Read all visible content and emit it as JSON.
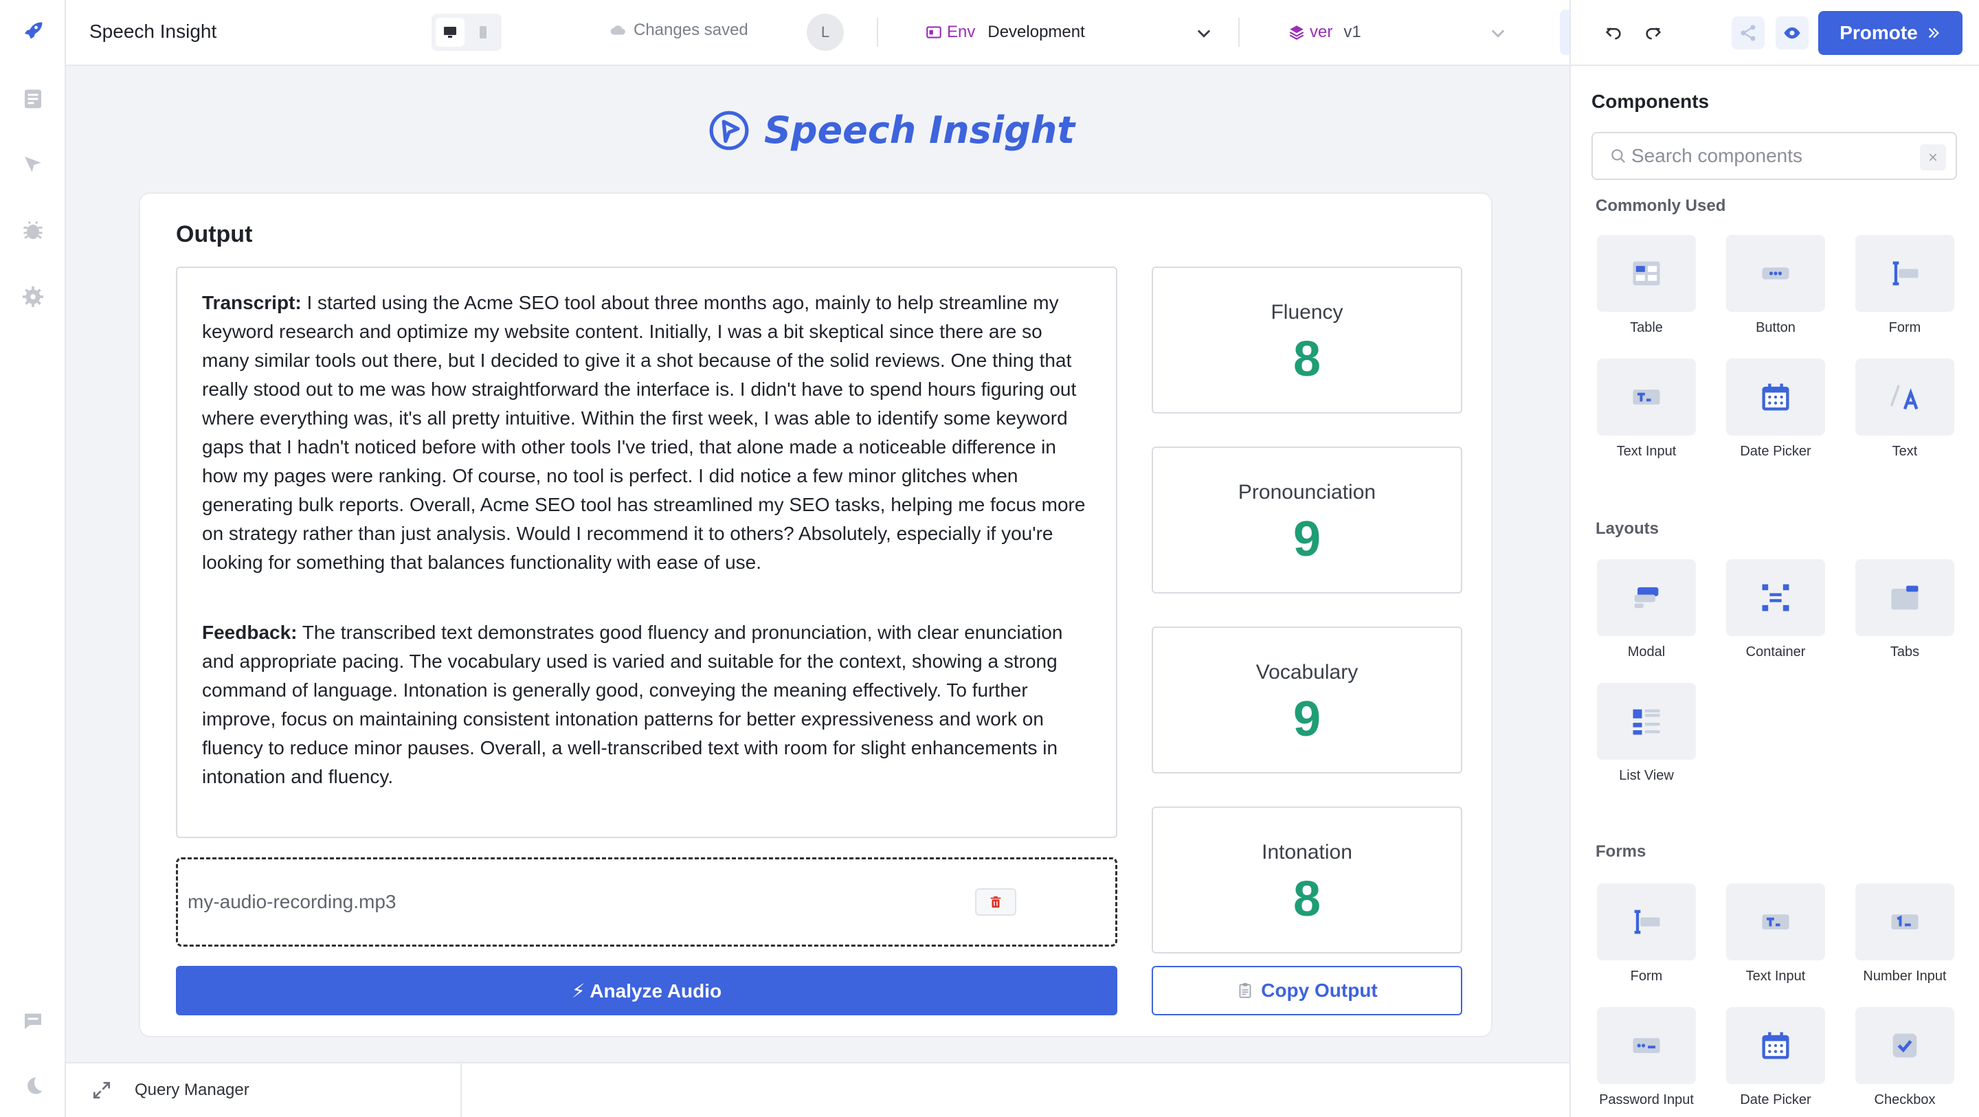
{
  "app": {
    "title": "Speech Insight"
  },
  "topbar": {
    "saved_status": "Changes saved",
    "avatar_initial": "L",
    "env_label": "Env",
    "env_value": "Development",
    "ver_label": "ver",
    "ver_value": "v1",
    "promote_label": "Promote"
  },
  "canvas": {
    "brand_title": "Speech Insight",
    "output_title": "Output",
    "transcript_label": "Transcript:",
    "transcript_text": " I started using the Acme SEO tool about three months ago, mainly to help streamline my keyword research and optimize my website content. Initially, I was a bit skeptical since there are so many similar tools out there, but I decided to give it a shot because of the solid reviews. One thing that really stood out to me was how straightforward the interface is. I didn't have to spend hours figuring out where everything was, it's all pretty intuitive. Within the first week, I was able to identify some keyword gaps that I hadn't noticed before with other tools I've tried, that alone made a noticeable difference in how my pages were ranking. Of course, no tool is perfect. I did notice a few minor glitches when generating bulk reports. Overall, Acme SEO tool has streamlined my SEO tasks, helping me focus more on strategy rather than just analysis. Would I recommend it to others? Absolutely, especially if you're looking for something that balances functionality with ease of use.",
    "feedback_label": "Feedback:",
    "feedback_text": " The transcribed text demonstrates good fluency and pronunciation, with clear enunciation and appropriate pacing. The vocabulary used is varied and suitable for the context, showing a strong command of language. Intonation is generally good, conveying the meaning effectively. To further improve, focus on maintaining consistent intonation patterns for better expressiveness and work on fluency to reduce minor pauses. Overall, a well-transcribed text with room for slight enhancements in intonation and fluency.",
    "scores": [
      {
        "label": "Fluency",
        "value": "8"
      },
      {
        "label": "Pronounciation",
        "value": "9"
      },
      {
        "label": "Vocabulary",
        "value": "9"
      },
      {
        "label": "Intonation",
        "value": "8"
      }
    ],
    "file_name": "my-audio-recording.mp3",
    "analyze_label": "⚡ Analyze Audio",
    "copy_label": "Copy Output"
  },
  "query_manager": {
    "label": "Query Manager"
  },
  "components_panel": {
    "title": "Components",
    "search_placeholder": "Search components",
    "sections": {
      "commonly_used": "Commonly Used",
      "layouts": "Layouts",
      "forms": "Forms"
    },
    "commonly_used": [
      "Table",
      "Button",
      "Form",
      "Text Input",
      "Date Picker",
      "Text"
    ],
    "layouts": [
      "Modal",
      "Container",
      "Tabs",
      "List View"
    ],
    "forms": [
      "Form",
      "Text Input",
      "Number Input",
      "Password Input",
      "Date Picker",
      "Checkbox"
    ]
  },
  "colors": {
    "accent": "#3d63dd",
    "score": "#1f9d74",
    "env_tag": "#9b2fb6"
  }
}
